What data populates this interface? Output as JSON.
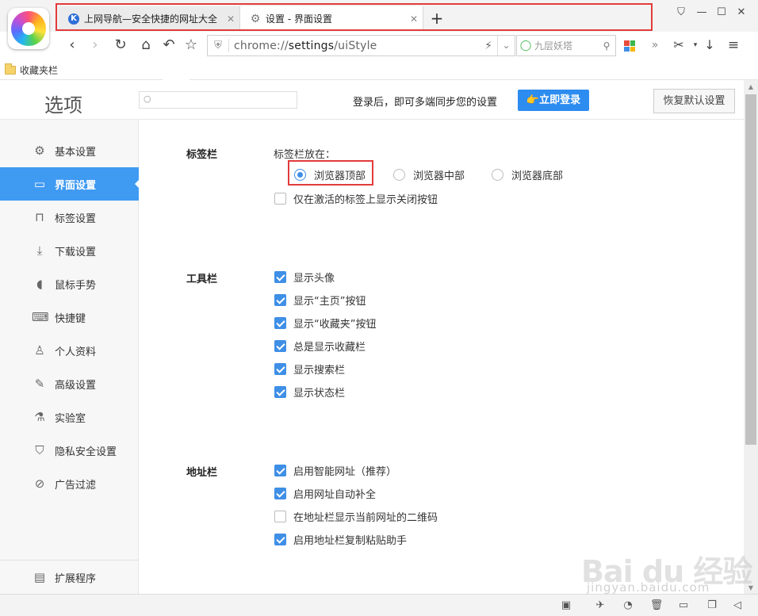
{
  "browser": {
    "tabs": [
      {
        "label": "上网导航—安全快捷的网址大全",
        "icon": "k-logo-icon"
      },
      {
        "label": "设置 - 界面设置",
        "icon": "gear-icon"
      }
    ],
    "address": {
      "scheme": "chrome://",
      "host": "settings",
      "path": "/uiStyle"
    },
    "search": {
      "text": "九层妖塔"
    },
    "bookmarks": [
      {
        "label": "收藏夹栏"
      }
    ]
  },
  "settings": {
    "title": "选项",
    "login_tip": "登录后，即可多端同步您的设置",
    "login_button": "👉立即登录",
    "reset_button": "恢复默认设置",
    "nav": [
      {
        "label": "基本设置",
        "icon": "gear-icon"
      },
      {
        "label": "界面设置",
        "icon": "window-icon",
        "active": true
      },
      {
        "label": "标签设置",
        "icon": "tab-icon"
      },
      {
        "label": "下载设置",
        "icon": "download-icon"
      },
      {
        "label": "鼠标手势",
        "icon": "mouse-icon"
      },
      {
        "label": "快捷键",
        "icon": "keyboard-icon"
      },
      {
        "label": "个人资料",
        "icon": "user-icon"
      },
      {
        "label": "高级设置",
        "icon": "wrench-icon"
      },
      {
        "label": "实验室",
        "icon": "flask-icon"
      },
      {
        "label": "隐私安全设置",
        "icon": "shield-icon"
      },
      {
        "label": "广告过滤",
        "icon": "block-icon"
      }
    ],
    "extensions": {
      "label": "扩展程序",
      "icon": "extension-icon"
    },
    "tabbar": {
      "section": "标签栏",
      "placement_label": "标签栏放在：",
      "positions": [
        {
          "label": "浏览器顶部",
          "selected": true
        },
        {
          "label": "浏览器中部",
          "selected": false
        },
        {
          "label": "浏览器底部",
          "selected": false
        }
      ],
      "close_only_active": {
        "label": "仅在激活的标签上显示关闭按钮",
        "checked": false
      }
    },
    "toolbar": {
      "section": "工具栏",
      "options": [
        {
          "label": "显示头像",
          "checked": true
        },
        {
          "label": "显示“主页”按钮",
          "checked": true
        },
        {
          "label": "显示“收藏夹”按钮",
          "checked": true
        },
        {
          "label": "总是显示收藏栏",
          "checked": true
        },
        {
          "label": "显示搜索栏",
          "checked": true
        },
        {
          "label": "显示状态栏",
          "checked": true
        }
      ]
    },
    "addressbar": {
      "section": "地址栏",
      "options": [
        {
          "label": "启用智能网址（推荐）",
          "checked": true
        },
        {
          "label": "启用网址自动补全",
          "checked": true
        },
        {
          "label": "在地址栏显示当前网址的二维码",
          "checked": false
        },
        {
          "label": "启用地址栏复制粘贴助手",
          "checked": true
        }
      ]
    }
  },
  "watermark": {
    "brand": "Bai du 经验",
    "url": "jingyan.baidu.com"
  },
  "colors": {
    "accent": "#3f9af2",
    "highlight": "#e23b3b",
    "login": "#2d8cf0"
  }
}
